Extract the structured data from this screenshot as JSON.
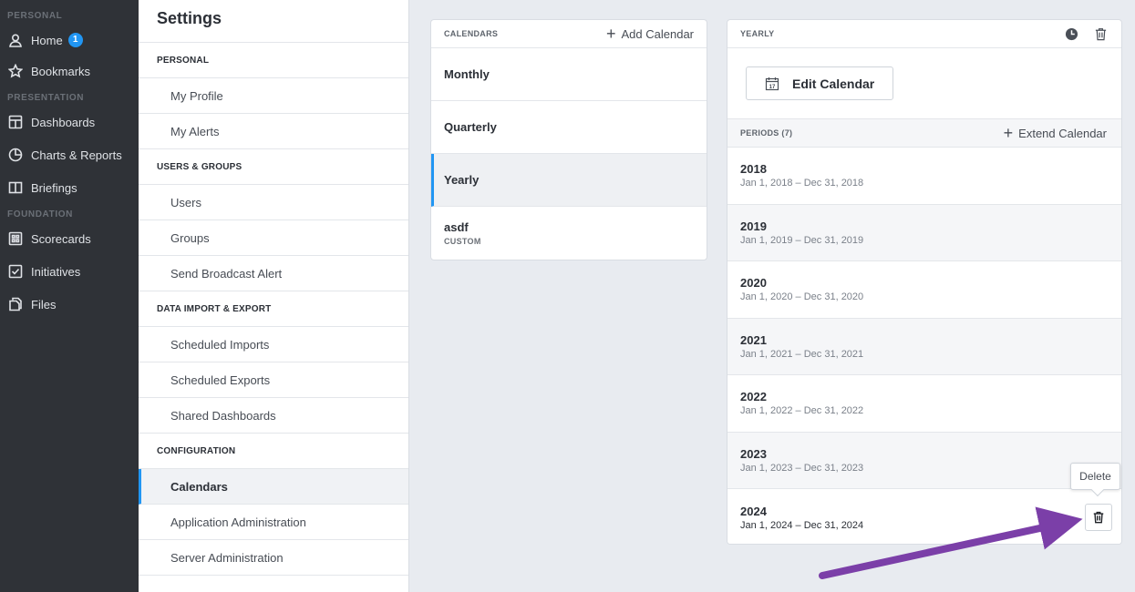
{
  "nav": {
    "sections": [
      {
        "label": "PERSONAL",
        "items": [
          {
            "label": "Home",
            "icon": "user-icon",
            "badge": "1"
          },
          {
            "label": "Bookmarks",
            "icon": "star-icon"
          }
        ]
      },
      {
        "label": "PRESENTATION",
        "items": [
          {
            "label": "Dashboards",
            "icon": "dashboard-icon"
          },
          {
            "label": "Charts & Reports",
            "icon": "pie-chart-icon"
          },
          {
            "label": "Briefings",
            "icon": "book-icon"
          }
        ]
      },
      {
        "label": "FOUNDATION",
        "items": [
          {
            "label": "Scorecards",
            "icon": "scorecard-icon"
          },
          {
            "label": "Initiatives",
            "icon": "checkbox-icon"
          },
          {
            "label": "Files",
            "icon": "file-icon"
          }
        ]
      }
    ]
  },
  "settings": {
    "title": "Settings",
    "groups": [
      {
        "header": "PERSONAL",
        "items": [
          "My Profile",
          "My Alerts"
        ]
      },
      {
        "header": "USERS & GROUPS",
        "items": [
          "Users",
          "Groups",
          "Send Broadcast Alert"
        ]
      },
      {
        "header": "DATA IMPORT & EXPORT",
        "items": [
          "Scheduled Imports",
          "Scheduled Exports",
          "Shared Dashboards"
        ]
      },
      {
        "header": "CONFIGURATION",
        "items": [
          "Calendars",
          "Application Administration",
          "Server Administration"
        ]
      }
    ],
    "active_item": "Calendars"
  },
  "calendars": {
    "header": "CALENDARS",
    "add_label": "Add Calendar",
    "items": [
      {
        "name": "Monthly",
        "sub": ""
      },
      {
        "name": "Quarterly",
        "sub": ""
      },
      {
        "name": "Yearly",
        "sub": ""
      },
      {
        "name": "asdf",
        "sub": "CUSTOM"
      }
    ],
    "active": "Yearly"
  },
  "yearly": {
    "header": "YEARLY",
    "edit_label": "Edit Calendar",
    "calendar_icon_day": "17",
    "periods_header": "PERIODS (7)",
    "extend_label": "Extend Calendar",
    "periods": [
      {
        "year": "2018",
        "range": "Jan 1, 2018 – Dec 31, 2018"
      },
      {
        "year": "2019",
        "range": "Jan 1, 2019 – Dec 31, 2019"
      },
      {
        "year": "2020",
        "range": "Jan 1, 2020 – Dec 31, 2020"
      },
      {
        "year": "2021",
        "range": "Jan 1, 2021 – Dec 31, 2021"
      },
      {
        "year": "2022",
        "range": "Jan 1, 2022 – Dec 31, 2022"
      },
      {
        "year": "2023",
        "range": "Jan 1, 2023 – Dec 31, 2023"
      },
      {
        "year": "2024",
        "range": "Jan 1, 2024 – Dec 31, 2024"
      }
    ],
    "tooltip": "Delete"
  },
  "colors": {
    "accent": "#2196f3",
    "arrow": "#7b3fa8"
  }
}
